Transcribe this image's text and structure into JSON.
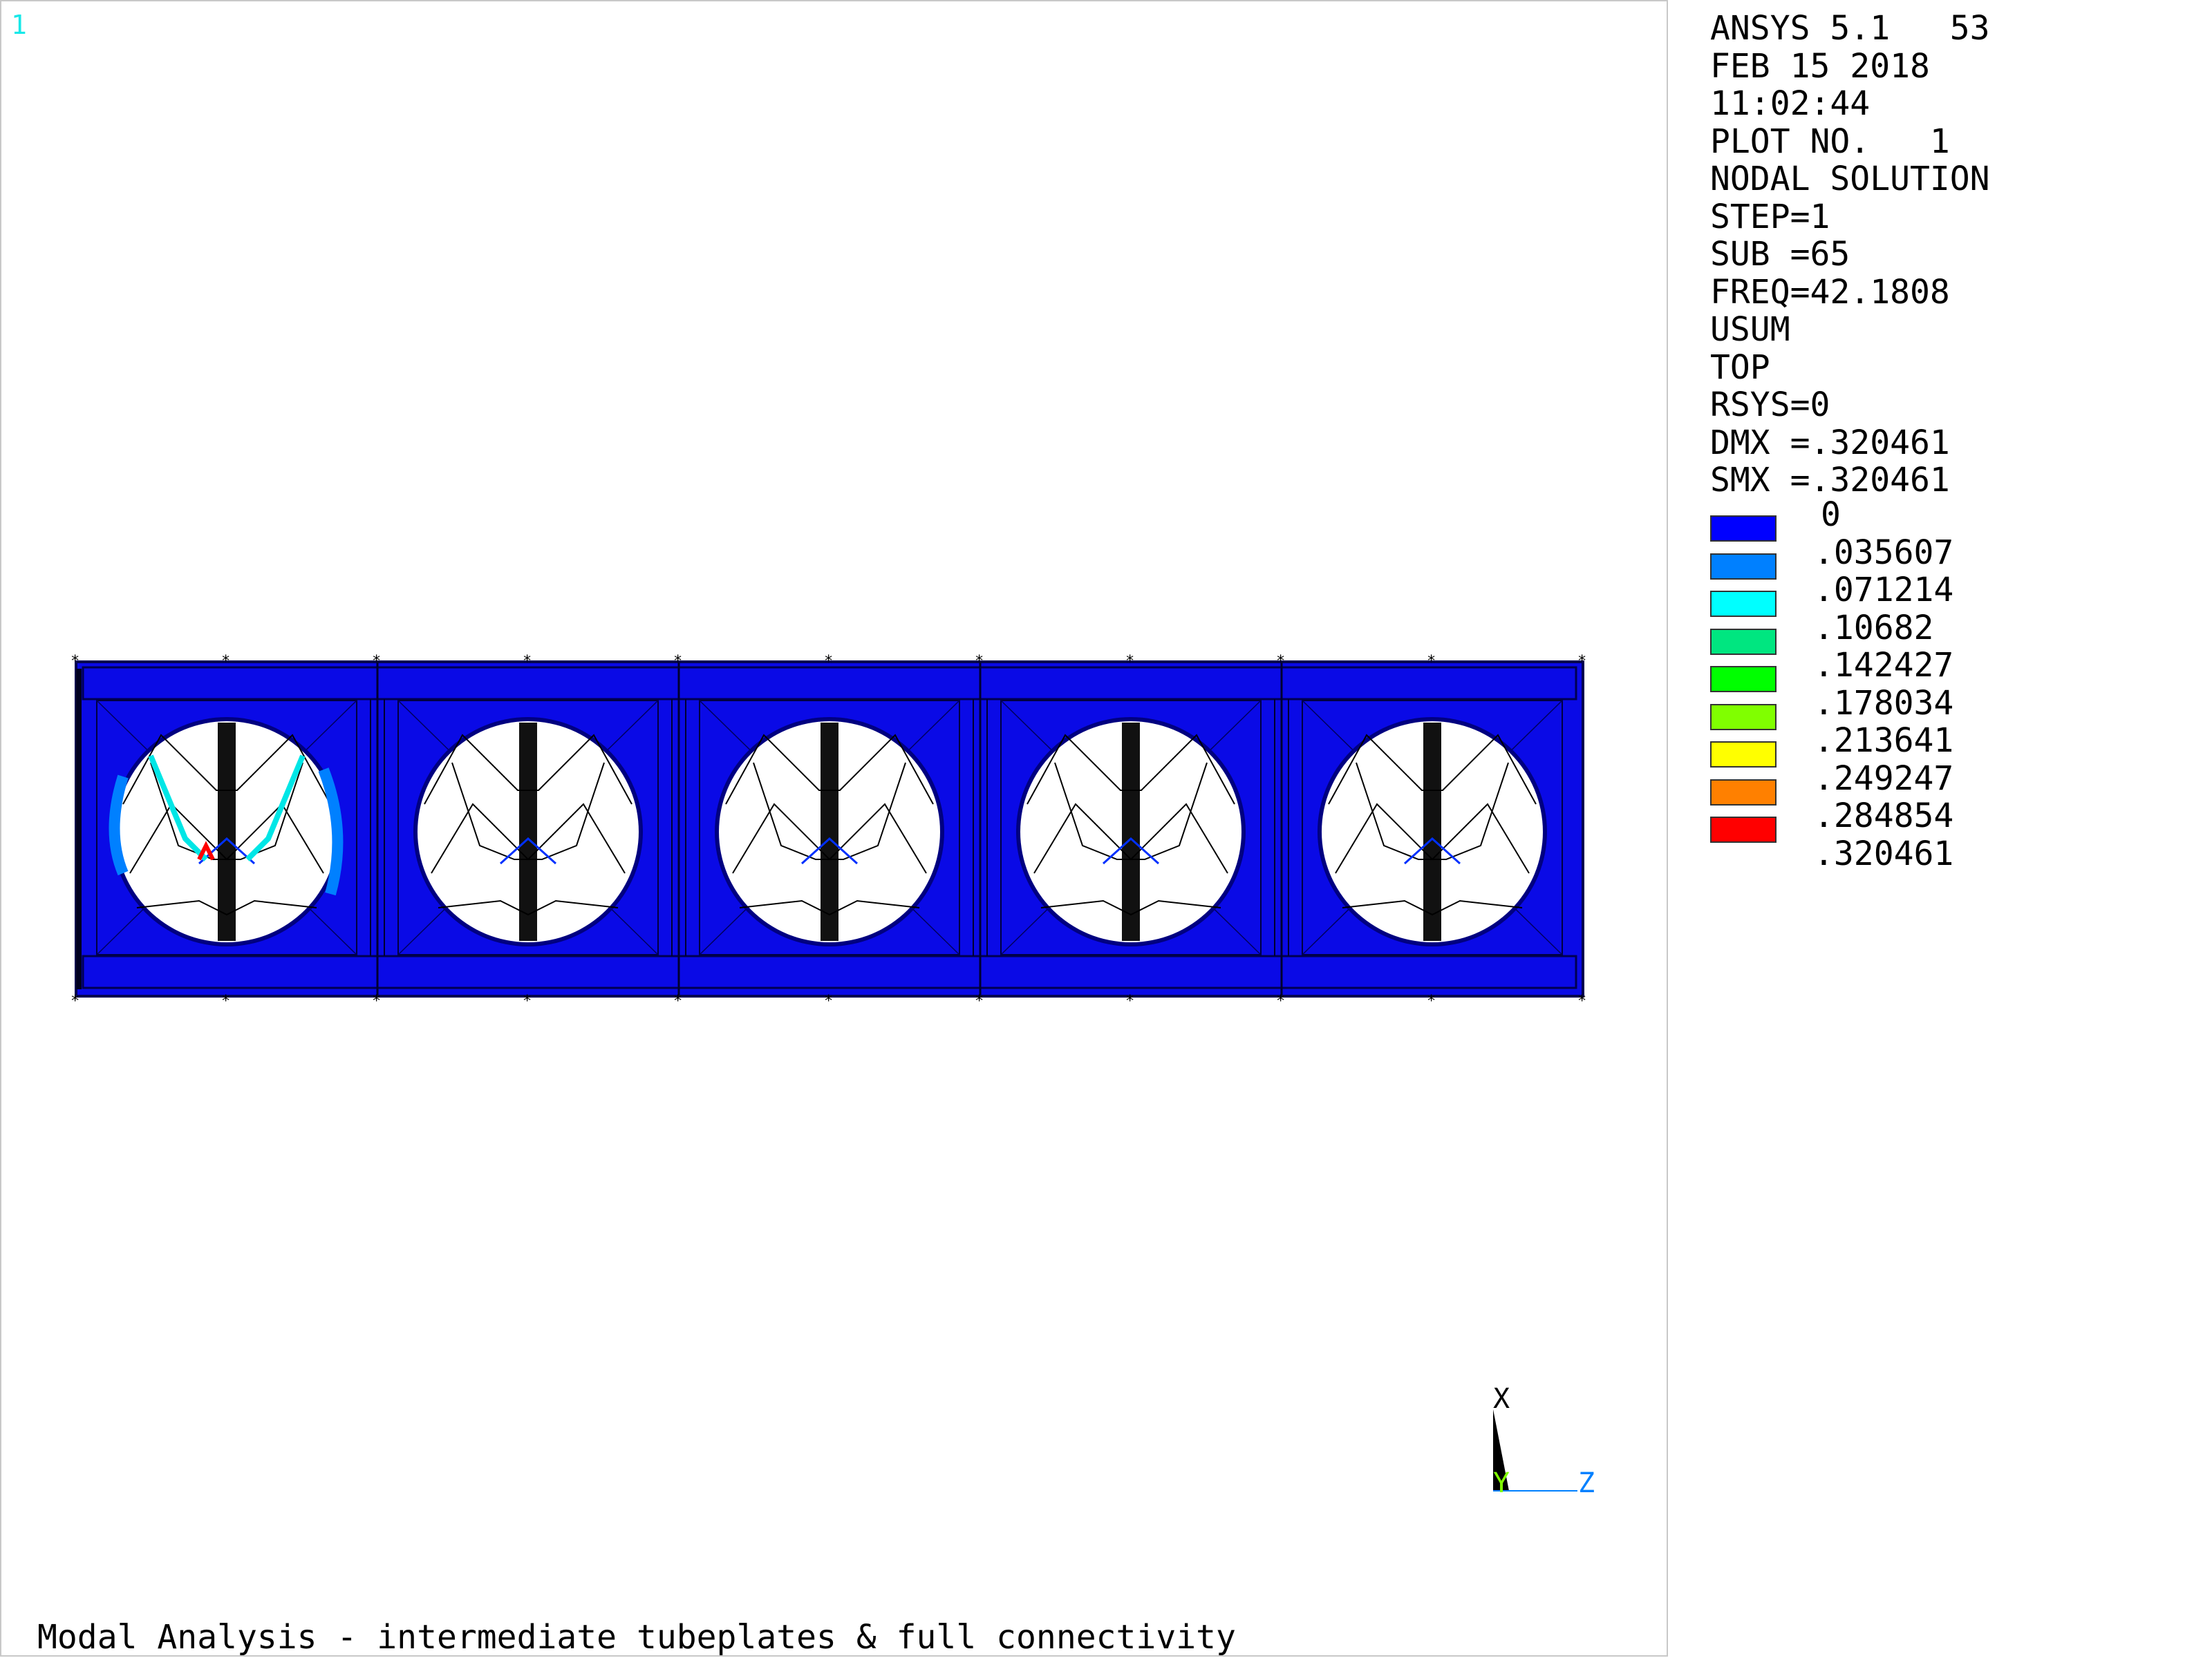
{
  "window": {
    "number": "1"
  },
  "info": {
    "lines": [
      "ANSYS 5.1   53",
      "FEB 15 2018",
      "11:02:44",
      "PLOT NO.   1",
      "NODAL SOLUTION",
      "STEP=1",
      "SUB =65",
      "FREQ=42.1808",
      "USUM",
      "TOP",
      "RSYS=0",
      "DMX =.320461",
      "SMX =.320461"
    ]
  },
  "legend": {
    "levels": [
      "0",
      ".035607",
      ".071214",
      ".10682",
      ".142427",
      ".178034",
      ".213641",
      ".249247",
      ".284854",
      ".320461"
    ],
    "colors": [
      "#0000ff",
      "#0080ff",
      "#00ffff",
      "#00e680",
      "#00ff00",
      "#80ff00",
      "#ffff00",
      "#ff8000",
      "#ff0000"
    ]
  },
  "model": {
    "bays": 5,
    "body_color": "#0a0ae6",
    "edge_color": "#000050",
    "mesh_color": "#000000",
    "deformed_bay": 1
  },
  "triad": {
    "x_label": "X",
    "y_label": "Y",
    "z_label": "Z",
    "x_color": "#000000",
    "y_color": "#80ff00",
    "z_color": "#0080ff"
  },
  "title": "Modal Analysis - intermediate tubeplates & full connectivity"
}
